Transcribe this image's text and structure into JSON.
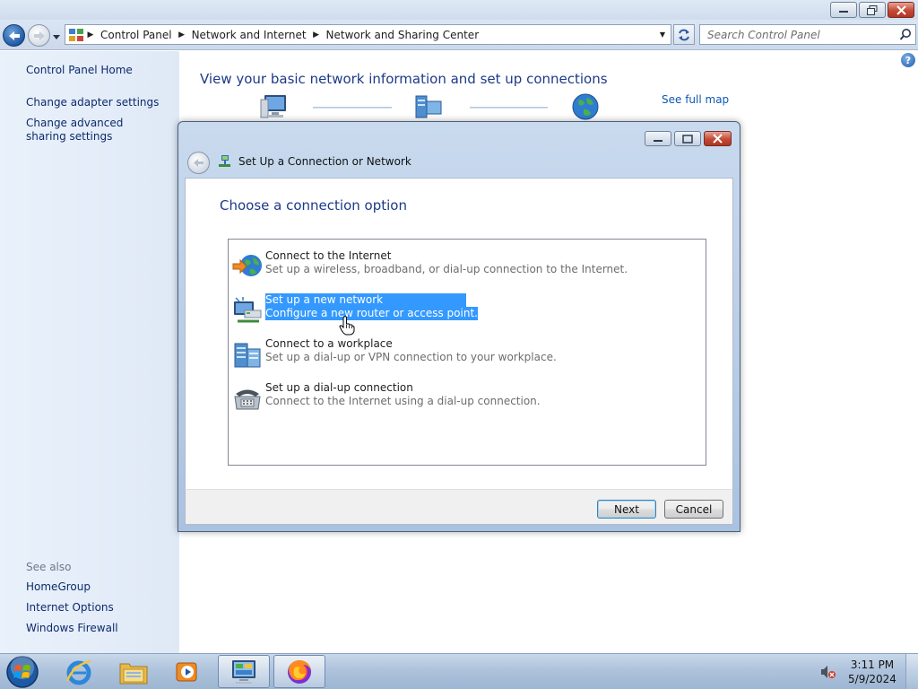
{
  "window": {
    "breadcrumbs": [
      "Control Panel",
      "Network and Internet",
      "Network and Sharing Center"
    ],
    "search_placeholder": "Search Control Panel"
  },
  "left_pane": {
    "links": [
      "Control Panel Home",
      "Change adapter settings",
      "Change advanced sharing settings"
    ],
    "see_also_heading": "See also",
    "see_also": [
      "HomeGroup",
      "Internet Options",
      "Windows Firewall"
    ]
  },
  "content": {
    "title": "View your basic network information and set up connections",
    "see_full_map": "See full map",
    "map_icons": [
      "computer-icon",
      "network-icon",
      "internet-globe-icon"
    ]
  },
  "dialog": {
    "title": "Set Up a Connection or Network",
    "heading": "Choose a connection option",
    "options": [
      {
        "title": "Connect to the Internet",
        "description": "Set up a wireless, broadband, or dial-up connection to the Internet.",
        "icon": "internet-globe-icon",
        "selected": false
      },
      {
        "title": "Set up a new network",
        "description": "Configure a new router or access point.",
        "icon": "new-network-icon",
        "selected": true
      },
      {
        "title": "Connect to a workplace",
        "description": "Set up a dial-up or VPN connection to your workplace.",
        "icon": "workplace-icon",
        "selected": false
      },
      {
        "title": "Set up a dial-up connection",
        "description": "Connect to the Internet using a dial-up connection.",
        "icon": "dialup-phone-icon",
        "selected": false
      }
    ],
    "buttons": {
      "next": "Next",
      "cancel": "Cancel"
    }
  },
  "taskbar": {
    "items": [
      "start-orb",
      "internet-explorer-icon",
      "windows-explorer-icon",
      "media-player-icon",
      "control-panel-network-icon",
      "firefox-icon"
    ],
    "active_item": "control-panel-network-icon",
    "clock": {
      "time": "3:11 PM",
      "date": "5/9/2024"
    },
    "tray_icons": [
      "volume-muted-icon"
    ]
  },
  "colors": {
    "link": "#0e2a6b",
    "heading": "#1c3a8a",
    "selection": "#3399ff",
    "left_pane_bg": "#e9f1fb"
  }
}
